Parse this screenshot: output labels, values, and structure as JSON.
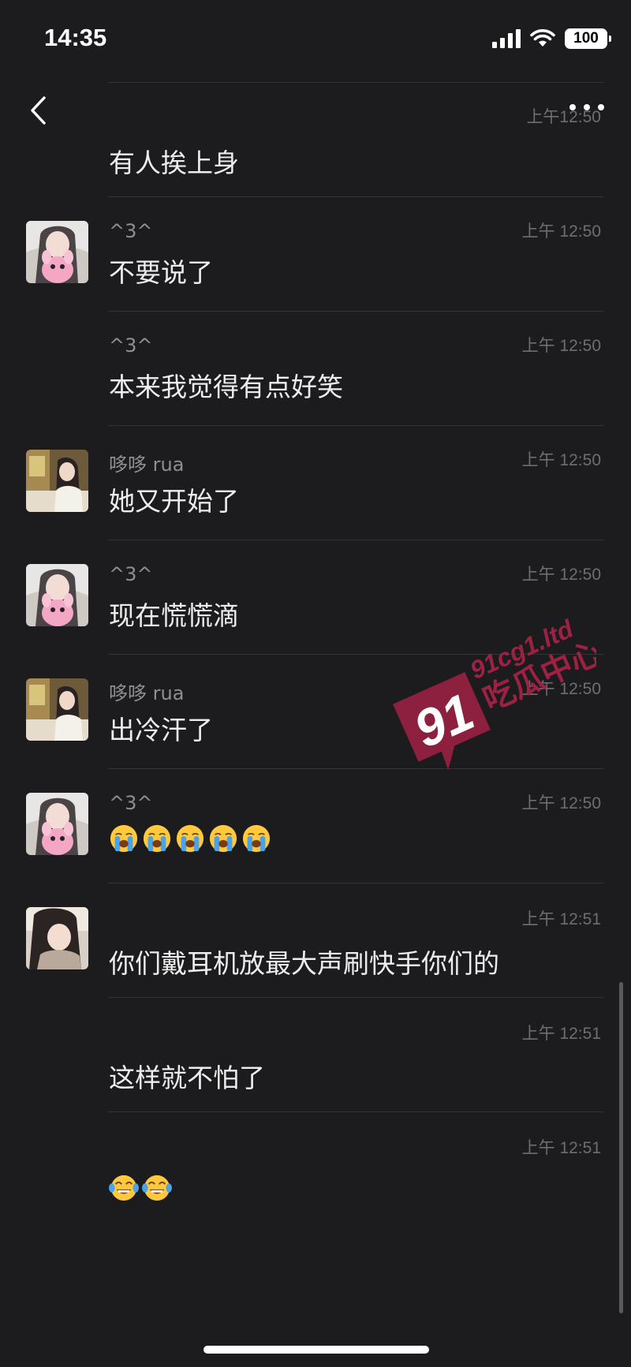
{
  "status_bar": {
    "time": "14:35",
    "battery": "100"
  },
  "navigation": {
    "back_icon": "chevron-left-icon",
    "more_icon": "ellipsis-icon"
  },
  "messages": [
    {
      "sender": "",
      "time": "上午12:50",
      "text": "有人挨上身",
      "avatar": "none"
    },
    {
      "sender": "^3^",
      "time": "上午 12:50",
      "text": "不要说了",
      "avatar": "girl-pink-plush"
    },
    {
      "sender": "^3^",
      "time": "上午 12:50",
      "text": "本来我觉得有点好笑",
      "avatar": "none"
    },
    {
      "sender": "哆哆 rua",
      "time": "上午 12:50",
      "text": "她又开始了",
      "avatar": "girl-cafe"
    },
    {
      "sender": "^3^",
      "time": "上午 12:50",
      "text": "现在慌慌滴",
      "avatar": "girl-pink-plush"
    },
    {
      "sender": "哆哆 rua",
      "time": "上午 12:50",
      "text": "出冷汗了",
      "avatar": "girl-cafe"
    },
    {
      "sender": "^3^",
      "time": "上午 12:50",
      "text": "",
      "emoji": "loudly-crying-face",
      "emoji_count": 5,
      "avatar": "girl-pink-plush"
    },
    {
      "sender": "",
      "time": "上午 12:51",
      "text": "你们戴耳机放最大声刷快手你们的",
      "avatar": "girl-long-hair"
    },
    {
      "sender": "",
      "time": "上午 12:51",
      "text": "这样就不怕了",
      "avatar": "none"
    },
    {
      "sender": "",
      "time": "上午 12:51",
      "text": "",
      "emoji": "tears-of-joy-face",
      "emoji_count": 2,
      "avatar": "none"
    }
  ],
  "watermark": {
    "logo_number": "91",
    "domain": "91cg1.ltd",
    "name": "吃瓜中心",
    "color": "#9c2143"
  }
}
